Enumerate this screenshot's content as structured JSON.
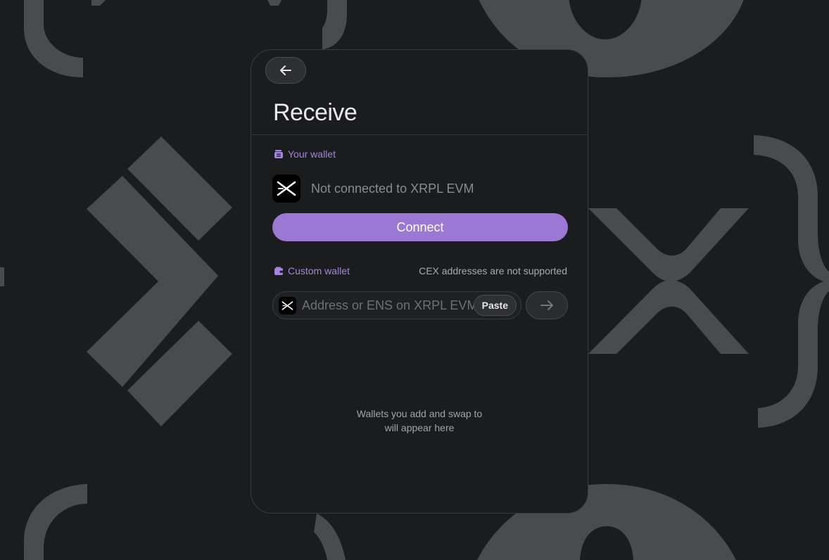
{
  "colors": {
    "background": "#1b1c1e",
    "card": "#1b1c1e",
    "accent": "#9a78d3",
    "accent_text": "#a585dc",
    "decor": "#4a4b4e"
  },
  "header": {
    "back_icon": "arrow-left-icon",
    "title": "Receive"
  },
  "your_wallet": {
    "label": "Your wallet",
    "icon": "wallet-icon",
    "chain_logo": "xrpl-evm-logo",
    "status": "Not connected to XRPL EVM",
    "connect_label": "Connect"
  },
  "custom_wallet": {
    "label": "Custom wallet",
    "icon": "wallet-icon",
    "note": "CEX addresses are not supported",
    "input_value": "",
    "input_placeholder": "Address or ENS on XRPL EVM",
    "paste_label": "Paste",
    "go_icon": "arrow-right-icon"
  },
  "empty_state": {
    "line1": "Wallets you add and swap to",
    "line2": "will appear here"
  }
}
